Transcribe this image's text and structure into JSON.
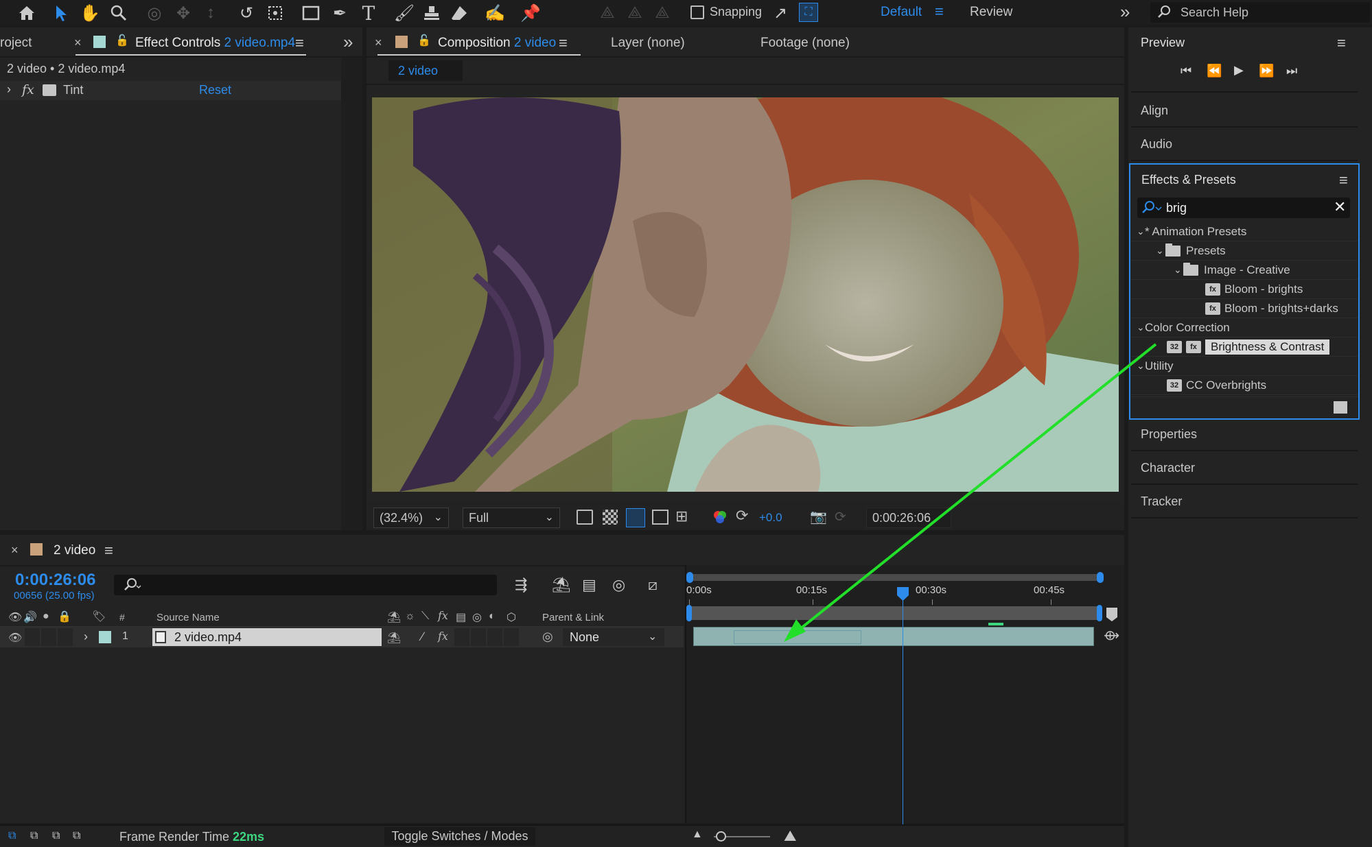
{
  "toolbar": {
    "snapping_label": "Snapping",
    "workspace_default": "Default",
    "workspace_review": "Review",
    "search_help_placeholder": "Search Help"
  },
  "project_panel": {
    "partial_tab_label": "roject"
  },
  "effect_controls": {
    "tab_prefix": "Effect Controls",
    "tab_file": "2 video.mp4",
    "breadcrumb": "2 video • 2 video.mp4",
    "effect_name": "Tint",
    "fx_symbol": "fx",
    "reset_label": "Reset"
  },
  "composition": {
    "tab_prefix": "Composition",
    "tab_name": "2 video",
    "layer_tab": "Layer (none)",
    "footage_tab": "Footage (none)",
    "subtab": "2 video",
    "zoom": "(32.4%)",
    "resolution": "Full",
    "exposure": "+0.0",
    "timecode": "0:00:26:06"
  },
  "preview": {
    "title": "Preview"
  },
  "right_panels": {
    "align": "Align",
    "audio": "Audio",
    "properties": "Properties",
    "character": "Character",
    "tracker": "Tracker"
  },
  "effects_presets": {
    "title": "Effects & Presets",
    "search_value": "brig",
    "tree": [
      {
        "label": "* Animation Presets",
        "type": "category"
      },
      {
        "label": "Presets",
        "type": "folder"
      },
      {
        "label": "Image - Creative",
        "type": "folder"
      },
      {
        "label": "Bloom - brights",
        "type": "preset"
      },
      {
        "label": "Bloom - brights+darks",
        "type": "preset"
      },
      {
        "label": "Color Correction",
        "type": "category"
      },
      {
        "label": "Brightness & Contrast",
        "type": "effect",
        "selected": true,
        "bits": "32"
      },
      {
        "label": "Utility",
        "type": "category"
      },
      {
        "label": "CC Overbrights",
        "type": "effect",
        "bits": "32"
      }
    ]
  },
  "timeline": {
    "comp_name": "2 video",
    "timecode": "0:00:26:06",
    "frame_info": "00656 (25.00 fps)",
    "col_number": "#",
    "col_source": "Source Name",
    "col_parent": "Parent & Link",
    "layer": {
      "index": "1",
      "name": "2 video.mp4",
      "parent": "None",
      "fx_symbol": "fx"
    },
    "ruler": [
      "0:00s",
      "00:15s",
      "00:30s",
      "00:45s"
    ],
    "playhead_seconds": 26.24,
    "duration_seconds": 59
  },
  "status_bar": {
    "frame_render_label": "Frame Render Time",
    "frame_render_value": "22ms",
    "toggle_label": "Toggle Switches / Modes"
  },
  "colors": {
    "accent_blue": "#2d8ceb",
    "annotation_green": "#22e02a",
    "render_time_green": "#3dd680",
    "layer_label_color": "#a5d8d3"
  }
}
